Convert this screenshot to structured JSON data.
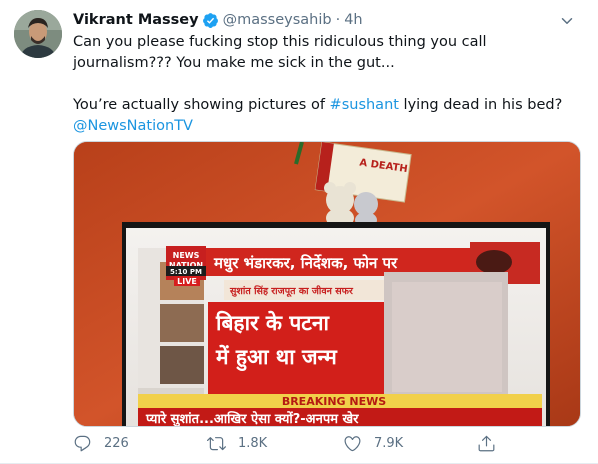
{
  "tweet": {
    "author_name": "Vikrant Massey",
    "handle": "@masseysahib",
    "separator": "·",
    "time": "4h",
    "line1": "Can you please fucking stop this ridiculous thing you call journalism??? You make me sick in the gut...",
    "line2_prefix": "You’re actually showing pictures of ",
    "hashtag": "#sushant",
    "line2_suffix": " lying dead in his bed?",
    "mention": "@NewsNationTV"
  },
  "media": {
    "calendar_text": "A DEATH",
    "channel_logo_line1": "NEWS",
    "channel_logo_line2": "NATION",
    "clock": "5:10 PM",
    "live": "LIVE",
    "headline_top": "मधुर भंडारकर, निर्देशक, फोन पर",
    "subheadline": "सुशांत सिंह राजपूत का जीवन सफर",
    "main_line1": "बिहार के पटना",
    "main_line2": "में हुआ था जन्म",
    "breaking": "BREAKING NEWS",
    "ticker": "प्यारे सुशांत...आखिर ऐसा क्यों?-अनपम खेर"
  },
  "actions": {
    "replies": "226",
    "retweets": "1.8K",
    "likes": "7.9K"
  },
  "colors": {
    "link": "#1b95e0",
    "muted": "#5b7083",
    "verified": "#1da1f2"
  },
  "icons": [
    "verified-badge-icon",
    "chevron-down-icon",
    "reply-icon",
    "retweet-icon",
    "like-icon",
    "share-icon"
  ]
}
